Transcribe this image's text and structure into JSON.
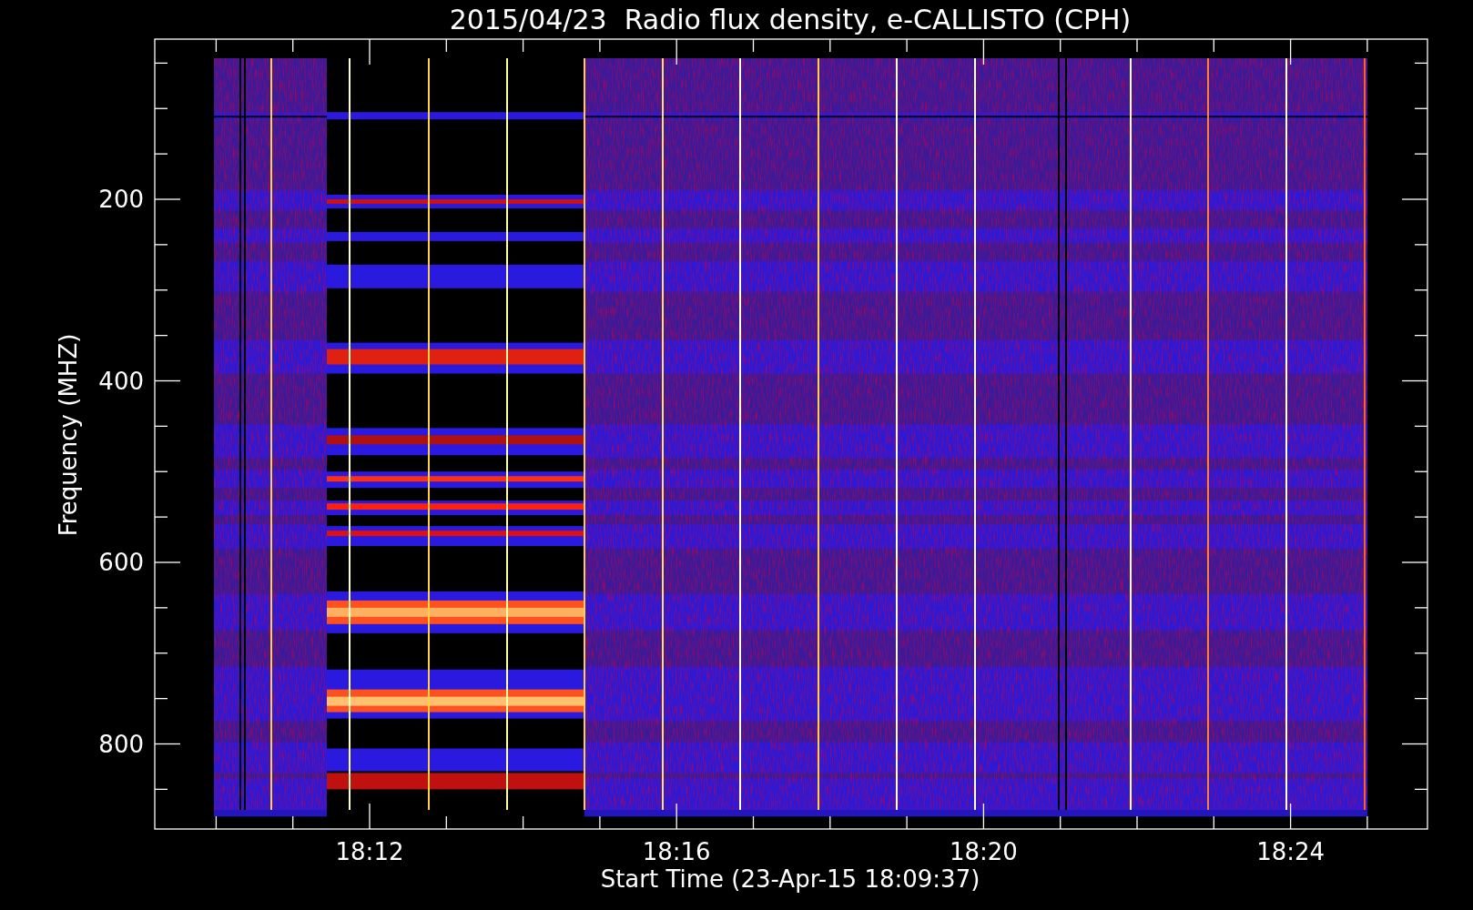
{
  "title": "2015/04/23  Radio flux density, e-CALLISTO (CPH)",
  "ylabel": "Frequency (MHZ)",
  "xlabel": "Start Time (23-Apr-15 18:09:37)",
  "yticks": [
    "200",
    "400",
    "600",
    "800"
  ],
  "xticks": [
    "18:12",
    "18:16",
    "18:20",
    "18:24"
  ]
}
